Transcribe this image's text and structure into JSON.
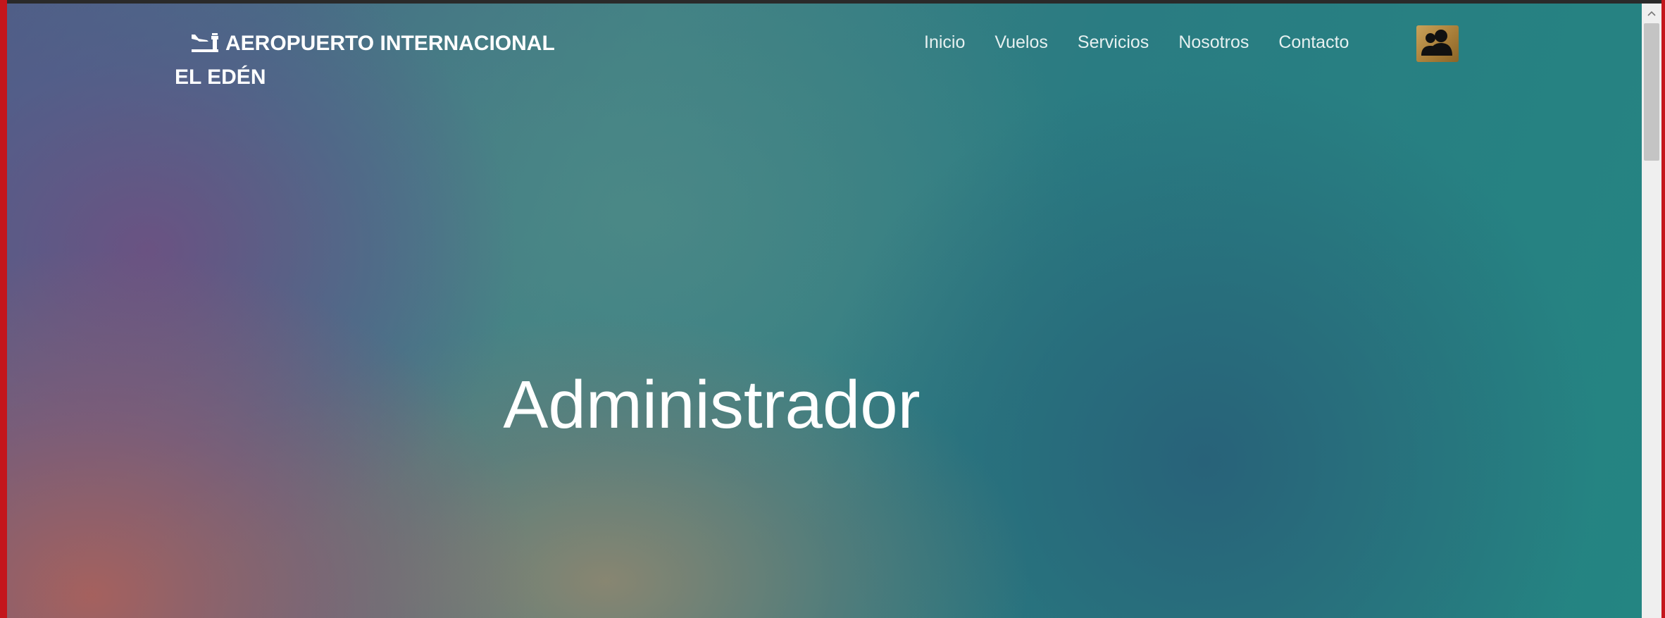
{
  "brand": {
    "line1": "AEROPUERTO INTERNACIONAL",
    "line2": "EL EDÉN",
    "icon": "airplane-landing-icon"
  },
  "nav": {
    "items": [
      "Inicio",
      "Vuelos",
      "Servicios",
      "Nosotros",
      "Contacto"
    ],
    "user_icon": "users-icon"
  },
  "hero": {
    "title": "Administrador"
  },
  "colors": {
    "accent_border": "#c4161c",
    "user_button": "#b8904a",
    "text": "#ffffff"
  }
}
